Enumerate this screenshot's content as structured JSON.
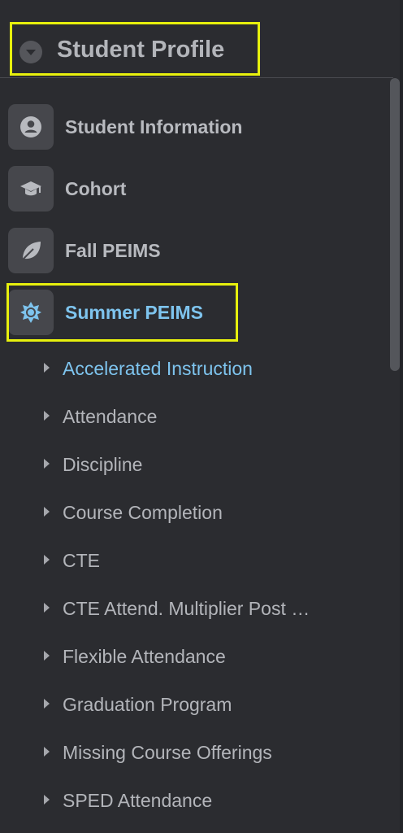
{
  "header": {
    "title": "Student Profile",
    "toggle_icon": "chevron-down-icon"
  },
  "sections": [
    {
      "label": "Student Information",
      "icon": "user-icon",
      "active": false
    },
    {
      "label": "Cohort",
      "icon": "graduation-cap-icon",
      "active": false
    },
    {
      "label": "Fall PEIMS",
      "icon": "leaf-icon",
      "active": false
    },
    {
      "label": "Summer PEIMS",
      "icon": "sun-icon",
      "active": true
    }
  ],
  "subitems": [
    {
      "label": "Accelerated Instruction",
      "active": true
    },
    {
      "label": "Attendance",
      "active": false
    },
    {
      "label": "Discipline",
      "active": false
    },
    {
      "label": "Course Completion",
      "active": false
    },
    {
      "label": "CTE",
      "active": false
    },
    {
      "label": "CTE Attend. Multiplier Post …",
      "active": false
    },
    {
      "label": "Flexible Attendance",
      "active": false
    },
    {
      "label": "Graduation Program",
      "active": false
    },
    {
      "label": "Missing Course Offerings",
      "active": false
    },
    {
      "label": "SPED Attendance",
      "active": false
    }
  ],
  "colors": {
    "background": "#2b2c30",
    "text": "#b3b5ba",
    "accent": "#7ec4ee",
    "highlight": "#e7f00d"
  }
}
